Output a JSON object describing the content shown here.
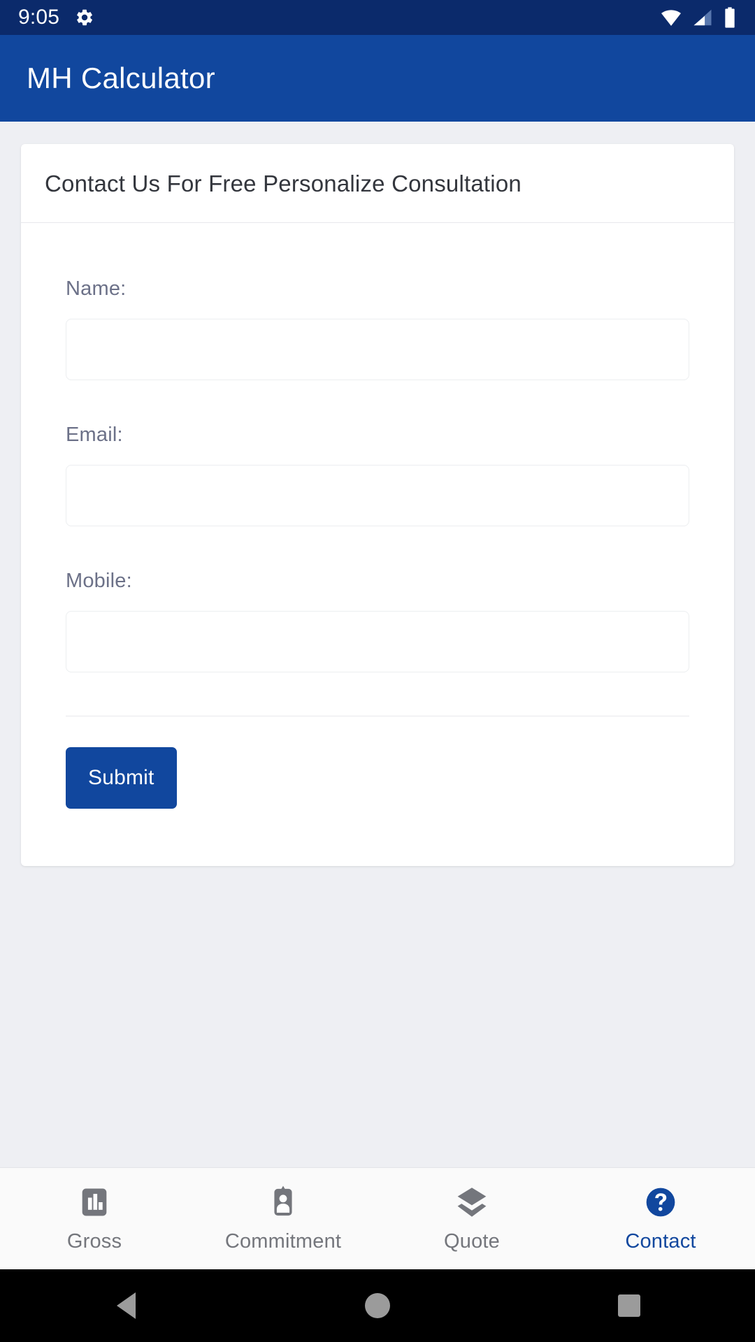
{
  "status_bar": {
    "time": "9:05",
    "icons": [
      "gear-icon",
      "wifi-icon",
      "cell-signal-icon",
      "battery-icon"
    ],
    "background_color": "#0b2a6b"
  },
  "app_bar": {
    "title": "MH Calculator",
    "background_color": "#11479e",
    "text_color": "#ffffff"
  },
  "card": {
    "title": "Contact Us For Free Personalize Consultation",
    "fields": [
      {
        "label": "Name:",
        "value": "",
        "placeholder": "",
        "name": "name-field"
      },
      {
        "label": "Email:",
        "value": "",
        "placeholder": "",
        "name": "email-field"
      },
      {
        "label": "Mobile:",
        "value": "",
        "placeholder": "",
        "name": "mobile-field"
      }
    ],
    "submit_label": "Submit",
    "submit_color": "#11479e"
  },
  "tab_bar": {
    "active_color": "#11479e",
    "inactive_color": "#74767c",
    "tabs": [
      {
        "label": "Gross",
        "icon": "bar-chart-icon",
        "active": false
      },
      {
        "label": "Commitment",
        "icon": "id-badge-icon",
        "active": false
      },
      {
        "label": "Quote",
        "icon": "layers-icon",
        "active": false
      },
      {
        "label": "Contact",
        "icon": "help-circle-icon",
        "active": true
      }
    ]
  },
  "nav_bar": {
    "buttons": [
      "back-button",
      "home-button",
      "recents-button"
    ]
  }
}
